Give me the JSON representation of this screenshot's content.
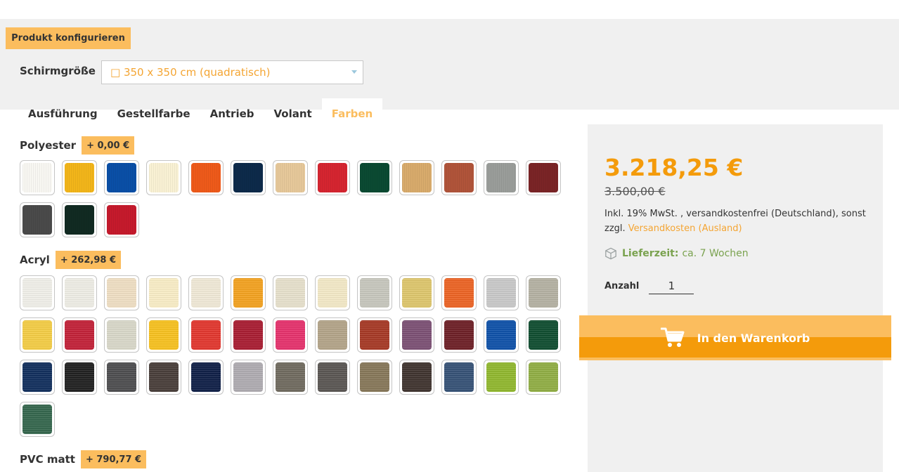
{
  "config": {
    "section_label": "Produkt konfigurieren",
    "size_label": "Schirmgröße",
    "size_value": "□ 350 x 350 cm (quadratisch)"
  },
  "tabs": [
    {
      "label": "Ausführung"
    },
    {
      "label": "Gestellfarbe"
    },
    {
      "label": "Antrieb"
    },
    {
      "label": "Volant"
    },
    {
      "label": "Farben",
      "active": true
    }
  ],
  "groups": {
    "polyester": {
      "name": "Polyester",
      "price": "+ 0,00 €",
      "swatches": [
        "#f8f7f2",
        "#f2b51a",
        "#0a4fa6",
        "#f9f1d4",
        "#ee5a1a",
        "#0d2a4a",
        "#e6c89a",
        "#d52530",
        "#0b4a32",
        "#d8ab6c",
        "#b0543a",
        "#9a9d9a",
        "#7a2426",
        "#4a4a4a",
        "#112a22",
        "#c51a2c"
      ]
    },
    "acryl": {
      "name": "Acryl",
      "price": "+ 262,98 €",
      "swatches": [
        "#f1f0ea",
        "#efeee6",
        "#f0dfc3",
        "#faeec6",
        "#f1ead7",
        "#f4a11c",
        "#e7e1cc",
        "#f4eac7",
        "#c7c7bd",
        "#dec66a",
        "#ed6120",
        "#c9c9c9",
        "#b4b1a2",
        "#f5cd42",
        "#c21d34",
        "#d9d8c9",
        "#f8c11b",
        "#e2332a",
        "#a8182e",
        "#e62e6a",
        "#b3a387",
        "#a53521",
        "#7a4d72",
        "#6b1b22",
        "#0a4ea8",
        "#0b4a2c",
        "#0d2b5a",
        "#1c1c1c",
        "#4a4a4c",
        "#453a36",
        "#0b1b44",
        "#aeabb0",
        "#6d685c",
        "#575350",
        "#857556",
        "#3c302b",
        "#324f74",
        "#8fb72a",
        "#8fad41",
        "#31644a"
      ]
    },
    "pvc": {
      "name": "PVC matt",
      "price": "+ 790,77 €"
    }
  },
  "price_panel": {
    "current_price": "3.218,25 €",
    "old_price": "3.500,00 €",
    "tax_note_prefix": "Inkl. 19% MwSt. , versandkostenfrei (Deutschland), sonst zzgl. ",
    "tax_note_link": "Versandkosten (Ausland)",
    "delivery_label": "Lieferzeit:",
    "delivery_value": "ca. 7 Wochen",
    "qty_label": "Anzahl",
    "qty_value": "1",
    "cart_button": "In den Warenkorb"
  },
  "colors": {
    "accent": "#fbbd5e",
    "price": "#f49b0b",
    "delivery": "#7aa24f",
    "panel_bg": "#f0f0f0"
  },
  "icons": {
    "cart": "cart-icon",
    "delivery": "package-icon",
    "dropdown": "chevron-down-icon"
  }
}
